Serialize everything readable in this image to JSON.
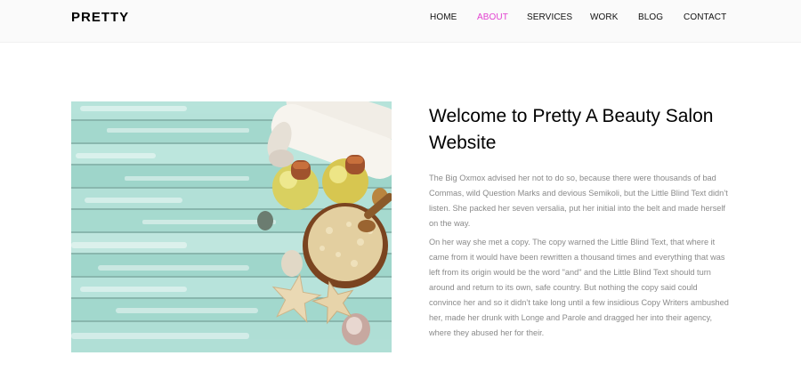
{
  "brand": {
    "name": "PRETTY"
  },
  "nav": {
    "items": [
      {
        "label": "HOME"
      },
      {
        "label": "ABOUT"
      },
      {
        "label": "SERVICES"
      },
      {
        "label": "WORK"
      },
      {
        "label": "BLOG"
      },
      {
        "label": "CONTACT"
      }
    ],
    "active": "ABOUT"
  },
  "about": {
    "heading": "Welcome to Pretty A Beauty Salon Website",
    "paragraphs": [
      "The Big Oxmox advised her not to do so, because there were thousands of bad Commas, wild Question Marks and devious Semikoli, but the Little Blind Text didn’t listen. She packed her seven versalia, put her initial into the belt and made herself on the way.",
      "On her way she met a copy. The copy warned the Little Blind Text, that where it came from it would have been rewritten a thousand times and everything that was left from its origin would be the word \"and\" and the Little Blind Text should turn around and return to its own, safe country. But nothing the copy said could convince her and so it didn’t take long until a few insidious Copy Writers ambushed her, made her drunk with Longe and Parole and dragged her into their agency, where they abused her for their."
    ]
  },
  "colors": {
    "accent": "#e23fd0",
    "header_bg": "#fafafa",
    "body_text": "#8a8a8a"
  }
}
